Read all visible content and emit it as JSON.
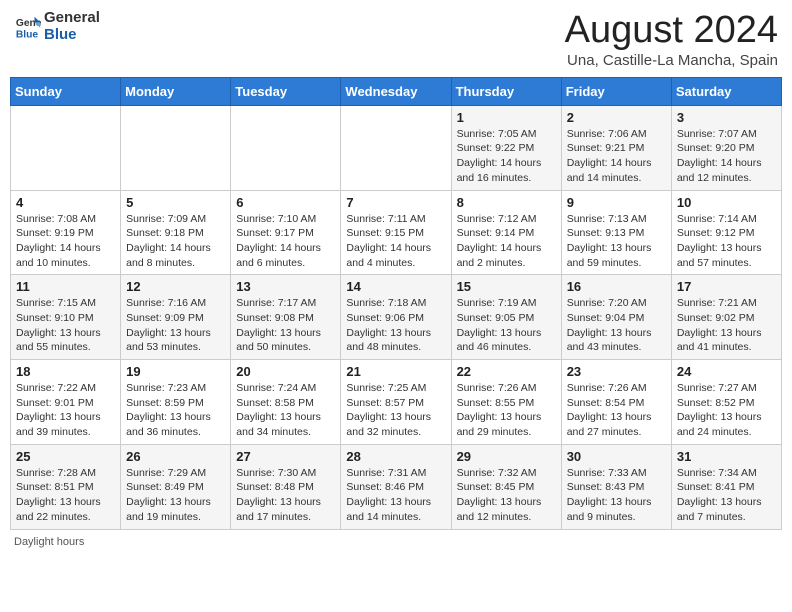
{
  "header": {
    "logo_line1": "General",
    "logo_line2": "Blue",
    "main_title": "August 2024",
    "subtitle": "Una, Castille-La Mancha, Spain"
  },
  "columns": [
    "Sunday",
    "Monday",
    "Tuesday",
    "Wednesday",
    "Thursday",
    "Friday",
    "Saturday"
  ],
  "weeks": [
    [
      {
        "day": "",
        "info": ""
      },
      {
        "day": "",
        "info": ""
      },
      {
        "day": "",
        "info": ""
      },
      {
        "day": "",
        "info": ""
      },
      {
        "day": "1",
        "info": "Sunrise: 7:05 AM\nSunset: 9:22 PM\nDaylight: 14 hours\nand 16 minutes."
      },
      {
        "day": "2",
        "info": "Sunrise: 7:06 AM\nSunset: 9:21 PM\nDaylight: 14 hours\nand 14 minutes."
      },
      {
        "day": "3",
        "info": "Sunrise: 7:07 AM\nSunset: 9:20 PM\nDaylight: 14 hours\nand 12 minutes."
      }
    ],
    [
      {
        "day": "4",
        "info": "Sunrise: 7:08 AM\nSunset: 9:19 PM\nDaylight: 14 hours\nand 10 minutes."
      },
      {
        "day": "5",
        "info": "Sunrise: 7:09 AM\nSunset: 9:18 PM\nDaylight: 14 hours\nand 8 minutes."
      },
      {
        "day": "6",
        "info": "Sunrise: 7:10 AM\nSunset: 9:17 PM\nDaylight: 14 hours\nand 6 minutes."
      },
      {
        "day": "7",
        "info": "Sunrise: 7:11 AM\nSunset: 9:15 PM\nDaylight: 14 hours\nand 4 minutes."
      },
      {
        "day": "8",
        "info": "Sunrise: 7:12 AM\nSunset: 9:14 PM\nDaylight: 14 hours\nand 2 minutes."
      },
      {
        "day": "9",
        "info": "Sunrise: 7:13 AM\nSunset: 9:13 PM\nDaylight: 13 hours\nand 59 minutes."
      },
      {
        "day": "10",
        "info": "Sunrise: 7:14 AM\nSunset: 9:12 PM\nDaylight: 13 hours\nand 57 minutes."
      }
    ],
    [
      {
        "day": "11",
        "info": "Sunrise: 7:15 AM\nSunset: 9:10 PM\nDaylight: 13 hours\nand 55 minutes."
      },
      {
        "day": "12",
        "info": "Sunrise: 7:16 AM\nSunset: 9:09 PM\nDaylight: 13 hours\nand 53 minutes."
      },
      {
        "day": "13",
        "info": "Sunrise: 7:17 AM\nSunset: 9:08 PM\nDaylight: 13 hours\nand 50 minutes."
      },
      {
        "day": "14",
        "info": "Sunrise: 7:18 AM\nSunset: 9:06 PM\nDaylight: 13 hours\nand 48 minutes."
      },
      {
        "day": "15",
        "info": "Sunrise: 7:19 AM\nSunset: 9:05 PM\nDaylight: 13 hours\nand 46 minutes."
      },
      {
        "day": "16",
        "info": "Sunrise: 7:20 AM\nSunset: 9:04 PM\nDaylight: 13 hours\nand 43 minutes."
      },
      {
        "day": "17",
        "info": "Sunrise: 7:21 AM\nSunset: 9:02 PM\nDaylight: 13 hours\nand 41 minutes."
      }
    ],
    [
      {
        "day": "18",
        "info": "Sunrise: 7:22 AM\nSunset: 9:01 PM\nDaylight: 13 hours\nand 39 minutes."
      },
      {
        "day": "19",
        "info": "Sunrise: 7:23 AM\nSunset: 8:59 PM\nDaylight: 13 hours\nand 36 minutes."
      },
      {
        "day": "20",
        "info": "Sunrise: 7:24 AM\nSunset: 8:58 PM\nDaylight: 13 hours\nand 34 minutes."
      },
      {
        "day": "21",
        "info": "Sunrise: 7:25 AM\nSunset: 8:57 PM\nDaylight: 13 hours\nand 32 minutes."
      },
      {
        "day": "22",
        "info": "Sunrise: 7:26 AM\nSunset: 8:55 PM\nDaylight: 13 hours\nand 29 minutes."
      },
      {
        "day": "23",
        "info": "Sunrise: 7:26 AM\nSunset: 8:54 PM\nDaylight: 13 hours\nand 27 minutes."
      },
      {
        "day": "24",
        "info": "Sunrise: 7:27 AM\nSunset: 8:52 PM\nDaylight: 13 hours\nand 24 minutes."
      }
    ],
    [
      {
        "day": "25",
        "info": "Sunrise: 7:28 AM\nSunset: 8:51 PM\nDaylight: 13 hours\nand 22 minutes."
      },
      {
        "day": "26",
        "info": "Sunrise: 7:29 AM\nSunset: 8:49 PM\nDaylight: 13 hours\nand 19 minutes."
      },
      {
        "day": "27",
        "info": "Sunrise: 7:30 AM\nSunset: 8:48 PM\nDaylight: 13 hours\nand 17 minutes."
      },
      {
        "day": "28",
        "info": "Sunrise: 7:31 AM\nSunset: 8:46 PM\nDaylight: 13 hours\nand 14 minutes."
      },
      {
        "day": "29",
        "info": "Sunrise: 7:32 AM\nSunset: 8:45 PM\nDaylight: 13 hours\nand 12 minutes."
      },
      {
        "day": "30",
        "info": "Sunrise: 7:33 AM\nSunset: 8:43 PM\nDaylight: 13 hours\nand 9 minutes."
      },
      {
        "day": "31",
        "info": "Sunrise: 7:34 AM\nSunset: 8:41 PM\nDaylight: 13 hours\nand 7 minutes."
      }
    ]
  ],
  "footer": {
    "daylight_label": "Daylight hours"
  }
}
